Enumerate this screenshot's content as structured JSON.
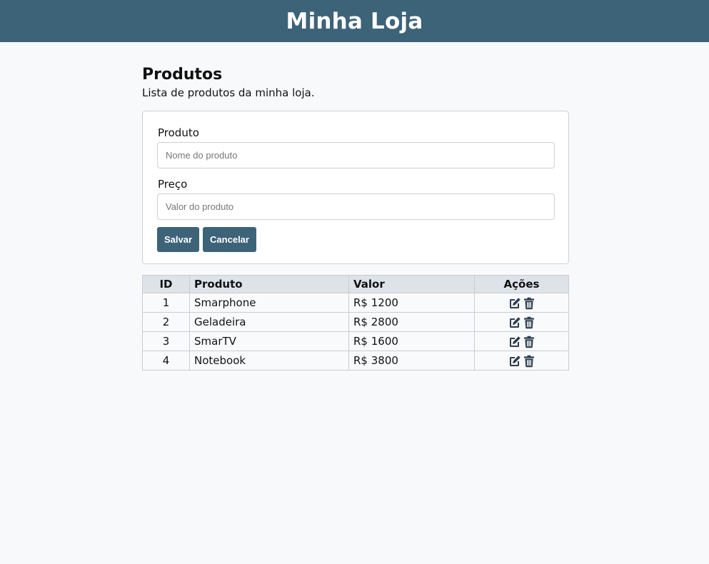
{
  "header": {
    "title": "Minha Loja"
  },
  "page": {
    "title": "Produtos",
    "description": "Lista de produtos da minha loja."
  },
  "form": {
    "product_label": "Produto",
    "product_placeholder": "Nome do produto",
    "product_value": "",
    "price_label": "Preço",
    "price_placeholder": "Valor do produto",
    "price_value": "",
    "save_label": "Salvar",
    "cancel_label": "Cancelar"
  },
  "table": {
    "headers": {
      "id": "ID",
      "product": "Produto",
      "value": "Valor",
      "actions": "Ações"
    },
    "rows": [
      {
        "id": "1",
        "product": "Smarphone",
        "value": "R$ 1200"
      },
      {
        "id": "2",
        "product": "Geladeira",
        "value": "R$ 2800"
      },
      {
        "id": "3",
        "product": "SmarTV",
        "value": "R$ 1600"
      },
      {
        "id": "4",
        "product": "Notebook",
        "value": "R$ 3800"
      }
    ],
    "row_actions": [
      "edit-icon",
      "trash-icon"
    ]
  },
  "colors": {
    "primary": "#3d6379",
    "header_row": "#dde3e9",
    "background": "#f8f9fb",
    "icon": "#2c3e50"
  }
}
